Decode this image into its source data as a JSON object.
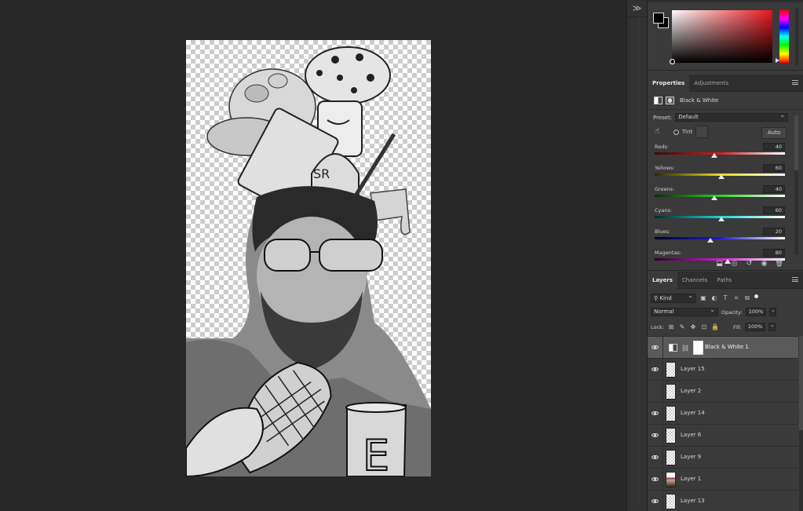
{
  "color_panel": {
    "colors": {
      "foreground": "#000000",
      "background": "#000000",
      "hue": "#e8161e"
    }
  },
  "properties": {
    "tabs": [
      {
        "label": "Properties",
        "active": true
      },
      {
        "label": "Adjustments",
        "active": false
      }
    ],
    "adjustment_name": "Black & White",
    "preset_label": "Preset:",
    "preset_value": "Default",
    "tint_label": "Tint",
    "auto_label": "Auto",
    "sliders": [
      {
        "label": "Reds:",
        "value": "40",
        "level": 0.46,
        "colors": [
          "#3a0a0a",
          "#d41a1a",
          "#ffffff"
        ]
      },
      {
        "label": "Yellows:",
        "value": "60",
        "level": 0.51,
        "colors": [
          "#2a2a00",
          "#e8d91a",
          "#ffffff"
        ]
      },
      {
        "label": "Greens:",
        "value": "40",
        "level": 0.46,
        "colors": [
          "#0a2a0a",
          "#2ad41a",
          "#ffffff"
        ]
      },
      {
        "label": "Cyans:",
        "value": "60",
        "level": 0.51,
        "colors": [
          "#002a2a",
          "#1ad4d4",
          "#ffffff"
        ]
      },
      {
        "label": "Blues:",
        "value": "20",
        "level": 0.43,
        "colors": [
          "#00002a",
          "#1a1ad4",
          "#ffffff"
        ]
      },
      {
        "label": "Magentas:",
        "value": "80",
        "level": 0.56,
        "colors": [
          "#2a002a",
          "#d41ad4",
          "#ffffff"
        ]
      }
    ]
  },
  "layers": {
    "tabs": [
      {
        "label": "Layers",
        "active": true
      },
      {
        "label": "Channels",
        "active": false
      },
      {
        "label": "Paths",
        "active": false
      }
    ],
    "filter_kind": "Kind",
    "blend_mode": "Normal",
    "opacity_label": "Opacity:",
    "opacity_value": "100%",
    "lock_label": "Lock:",
    "fill_label": "Fill:",
    "fill_value": "100%",
    "items": [
      {
        "name": "Black & White 1",
        "visible": true,
        "selected": true,
        "kind": "adjustment"
      },
      {
        "name": "Layer 15",
        "visible": true,
        "selected": false,
        "kind": "transparent"
      },
      {
        "name": "Layer 2",
        "visible": false,
        "selected": false,
        "kind": "transparent"
      },
      {
        "name": "Layer 14",
        "visible": true,
        "selected": false,
        "kind": "transparent"
      },
      {
        "name": "Layer 6",
        "visible": true,
        "selected": false,
        "kind": "transparent"
      },
      {
        "name": "Layer 9",
        "visible": true,
        "selected": false,
        "kind": "transparent"
      },
      {
        "name": "Layer 1",
        "visible": true,
        "selected": false,
        "kind": "photo"
      },
      {
        "name": "Layer 13",
        "visible": true,
        "selected": false,
        "kind": "transparent"
      }
    ]
  },
  "canvas": {
    "icons": [
      "transparency-checkerboard",
      "collage-illustration"
    ],
    "letters": [
      "SR",
      "E"
    ]
  }
}
